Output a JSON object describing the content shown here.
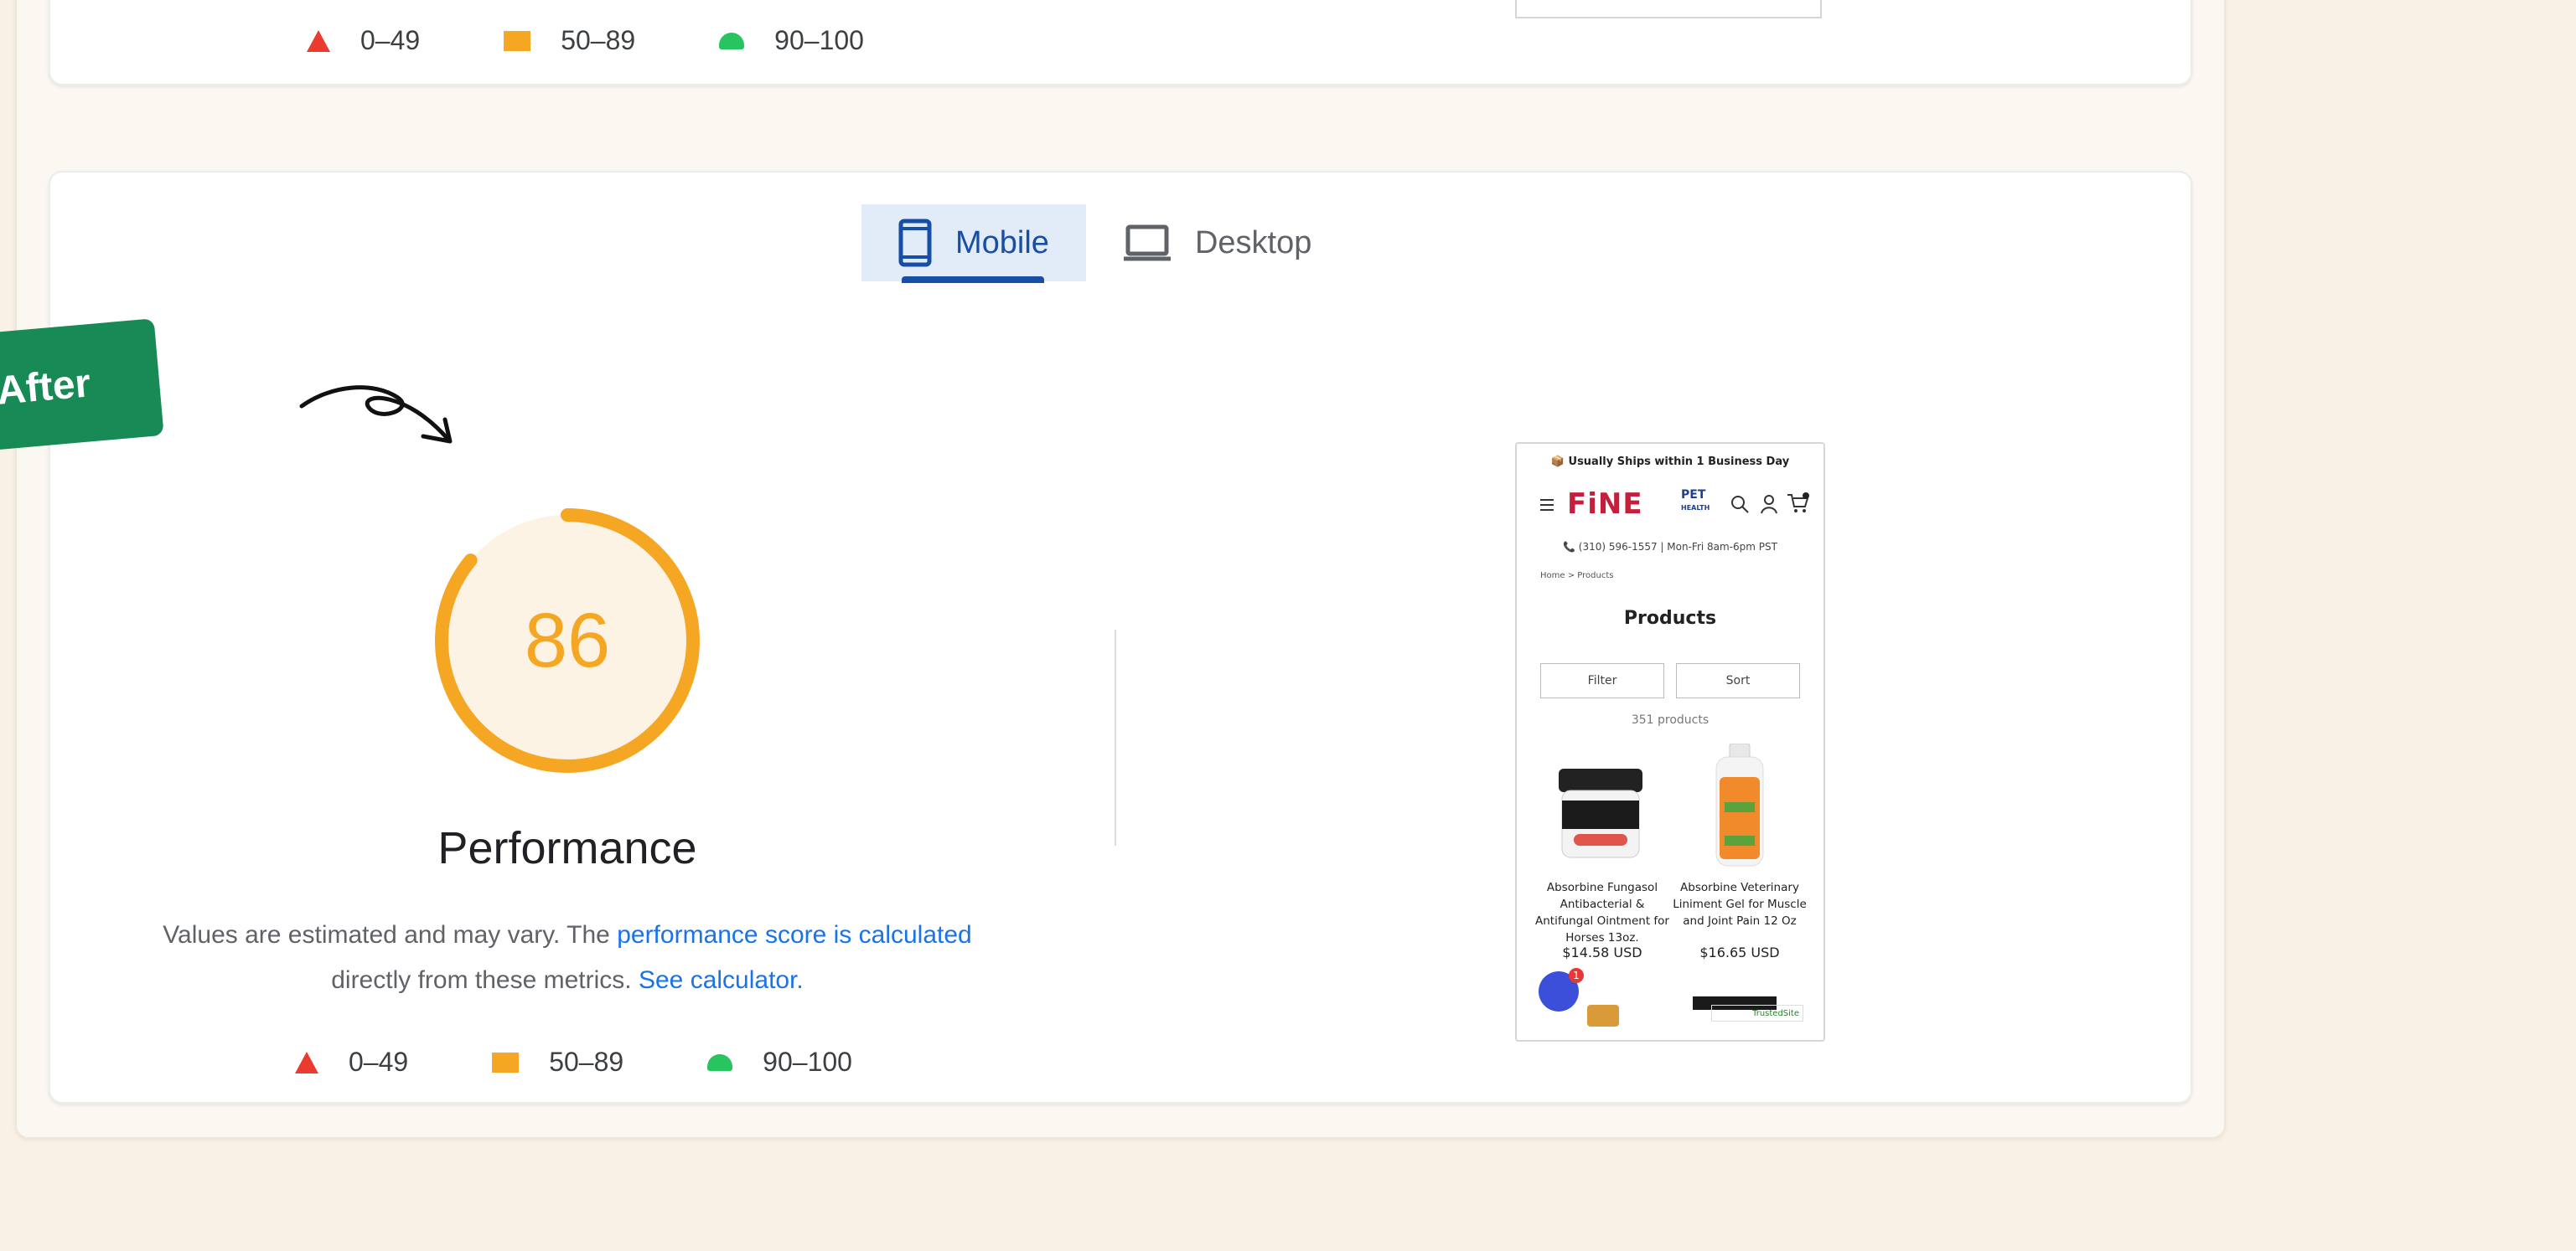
{
  "top_card": {
    "legend": [
      {
        "label": "0–49",
        "shape": "triangle-icon",
        "color": "#eb3b2f"
      },
      {
        "label": "50–89",
        "shape": "square-icon",
        "color": "#f5a623"
      },
      {
        "label": "90–100",
        "shape": "circle-icon",
        "color": "#27c45f"
      }
    ]
  },
  "tabs": {
    "mobile": "Mobile",
    "desktop": "Desktop",
    "active": "mobile"
  },
  "badge": {
    "label": "After"
  },
  "performance": {
    "score": "86",
    "score_value": 86,
    "title": "Performance",
    "note_prefix": "Values are estimated and may vary. The ",
    "note_link1": "performance score is calculated",
    "note_mid": "directly from these metrics. ",
    "note_link2": "See calculator.",
    "accent_color": "#f5a623"
  },
  "legend": [
    {
      "label": "0–49",
      "shape": "triangle-icon",
      "color": "#eb3b2f"
    },
    {
      "label": "50–89",
      "shape": "square-icon",
      "color": "#f5a623"
    },
    {
      "label": "90–100",
      "shape": "circle-icon",
      "color": "#27c45f"
    }
  ],
  "screenshot": {
    "banner": "📦 Usually Ships within 1 Business Day",
    "logo": "FiNE",
    "logo_sub1": "PET",
    "logo_sub2": "HEALTH",
    "phone": "📞 (310) 596-1557 | Mon-Fri 8am-6pm PST",
    "breadcrumb": "Home  >  Products",
    "heading": "Products",
    "filter": "Filter",
    "sort": "Sort",
    "count": "351 products",
    "products": [
      {
        "name": "Absorbine Fungasol Antibacterial & Antifungal Ointment for Horses 13oz.",
        "price": "$14.58 USD"
      },
      {
        "name": "Absorbine Veterinary Liniment Gel for Muscle and Joint Pain 12 Oz",
        "price": "$16.65 USD"
      }
    ],
    "chat_badge": "1",
    "trusted": "TrustedSite"
  }
}
